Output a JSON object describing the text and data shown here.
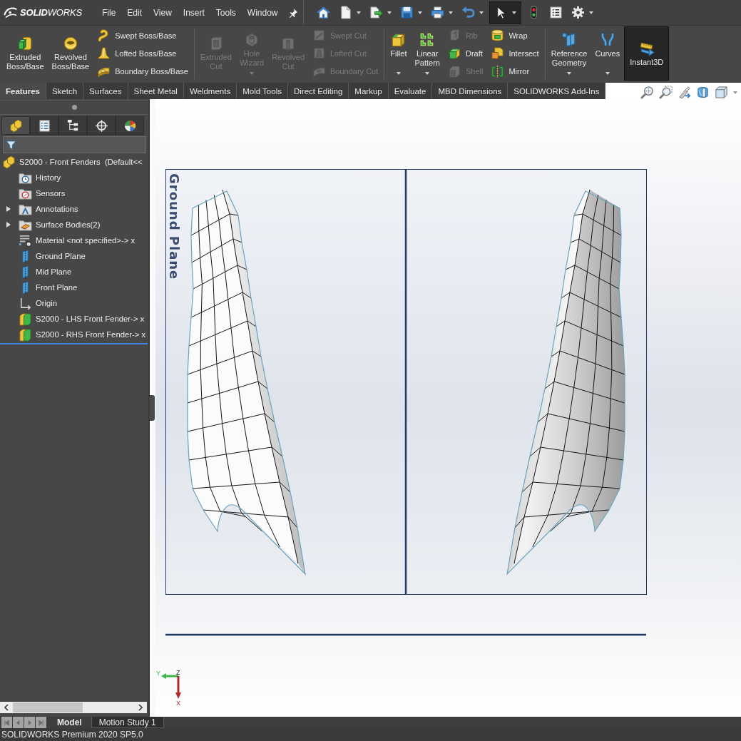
{
  "app": {
    "logo": "**SOLID**WORKS",
    "menu": [
      "File",
      "Edit",
      "View",
      "Insert",
      "Tools",
      "Window"
    ]
  },
  "quick_access": [
    {
      "dropdown": false,
      "on": false
    },
    {
      "dropdown": true,
      "on": false
    },
    {
      "dropdown": true,
      "on": false
    },
    {
      "dropdown": true,
      "on": false
    },
    {
      "dropdown": true,
      "on": false
    },
    {
      "dropdown": true,
      "on": false
    },
    {
      "dropdown": true,
      "on": true
    },
    {
      "dropdown": false,
      "on": false
    },
    {
      "dropdown": false,
      "on": false
    },
    {
      "dropdown": true,
      "on": false
    }
  ],
  "ribbon": {
    "groups": [
      {
        "commands": [
          {
            "kind": "large",
            "label": "Extruded Boss/Base",
            "disabled": false,
            "dropdown": false,
            "on": false
          },
          {
            "kind": "large",
            "label": "Revolved Boss/Base",
            "disabled": false,
            "dropdown": false,
            "on": false
          },
          {
            "kind": "stack",
            "items": [
              {
                "label": "Swept Boss/Base",
                "disabled": false
              },
              {
                "label": "Lofted Boss/Base",
                "disabled": false
              },
              {
                "label": "Boundary Boss/Base",
                "disabled": false
              }
            ]
          }
        ]
      },
      {
        "commands": [
          {
            "kind": "large",
            "label": "Extruded Cut",
            "disabled": true,
            "dropdown": false,
            "on": false
          },
          {
            "kind": "large",
            "label": "Hole Wizard",
            "disabled": true,
            "dropdown": true,
            "on": false
          },
          {
            "kind": "large",
            "label": "Revolved Cut",
            "disabled": true,
            "dropdown": false,
            "on": false
          },
          {
            "kind": "stack",
            "items": [
              {
                "label": "Swept Cut",
                "disabled": true
              },
              {
                "label": "Lofted Cut",
                "disabled": true
              },
              {
                "label": "Boundary Cut",
                "disabled": true
              }
            ]
          }
        ]
      },
      {
        "commands": [
          {
            "kind": "large",
            "label": "Fillet",
            "disabled": false,
            "dropdown": true,
            "on": false
          },
          {
            "kind": "large",
            "label": "Linear Pattern",
            "disabled": false,
            "dropdown": true,
            "on": false
          },
          {
            "kind": "stack",
            "items": [
              {
                "label": "Rib",
                "disabled": true
              },
              {
                "label": "Draft",
                "disabled": false
              },
              {
                "label": "Shell",
                "disabled": true
              }
            ]
          },
          {
            "kind": "stack",
            "items": [
              {
                "label": "Wrap",
                "disabled": false
              },
              {
                "label": "Intersect",
                "disabled": false
              },
              {
                "label": "Mirror",
                "disabled": false
              }
            ]
          }
        ]
      },
      {
        "commands": [
          {
            "kind": "large",
            "label": "Reference Geometry",
            "disabled": false,
            "dropdown": true,
            "on": false
          },
          {
            "kind": "large",
            "label": "Curves",
            "disabled": false,
            "dropdown": true,
            "on": false
          },
          {
            "kind": "large",
            "label": "Instant3D",
            "disabled": false,
            "dropdown": false,
            "on": true
          }
        ]
      }
    ]
  },
  "tabs": [
    {
      "label": "Features",
      "selected": true
    },
    {
      "label": "Sketch",
      "selected": false
    },
    {
      "label": "Surfaces",
      "selected": false
    },
    {
      "label": "Sheet Metal",
      "selected": false
    },
    {
      "label": "Weldments",
      "selected": false
    },
    {
      "label": "Mold Tools",
      "selected": false
    },
    {
      "label": "Direct Editing",
      "selected": false
    },
    {
      "label": "Markup",
      "selected": false
    },
    {
      "label": "Evaluate",
      "selected": false
    },
    {
      "label": "MBD Dimensions",
      "selected": false
    },
    {
      "label": "SOLIDWORKS Add-Ins",
      "selected": false
    }
  ],
  "panel": {
    "tabs": [
      {
        "selected": true
      },
      {
        "selected": false
      },
      {
        "selected": false
      },
      {
        "selected": false
      },
      {
        "selected": false
      }
    ],
    "tree": {
      "label": "S2000 - Front Fenders  (Default<<",
      "children": [
        {
          "kind": "history",
          "label": "History"
        },
        {
          "kind": "sensors",
          "label": "Sensors"
        },
        {
          "kind": "annotations",
          "label": "Annotations",
          "expanded": false
        },
        {
          "kind": "bodies",
          "label": "Surface Bodies(2)",
          "expanded": false
        },
        {
          "kind": "material",
          "label": "Material <not specified>-> x"
        },
        {
          "kind": "plane",
          "label": "Ground Plane"
        },
        {
          "kind": "plane",
          "label": "Mid Plane"
        },
        {
          "kind": "plane",
          "label": "Front Plane"
        },
        {
          "kind": "origin",
          "label": "Origin"
        },
        {
          "kind": "part",
          "label": "S2000 - LHS Front Fender-> x"
        },
        {
          "kind": "part",
          "label": "S2000 - RHS Front Fender-> x"
        }
      ]
    }
  },
  "viewport": {
    "plane_label": "Ground Plane",
    "axis_labels": {
      "y": "Y",
      "z": "Z",
      "x": "X"
    }
  },
  "bottom_tabs": [
    {
      "label": "Model",
      "selected": true
    },
    {
      "label": "Motion Study 1",
      "selected": false
    }
  ],
  "status_bar": "SOLIDWORKS Premium 2020 SP5.0"
}
